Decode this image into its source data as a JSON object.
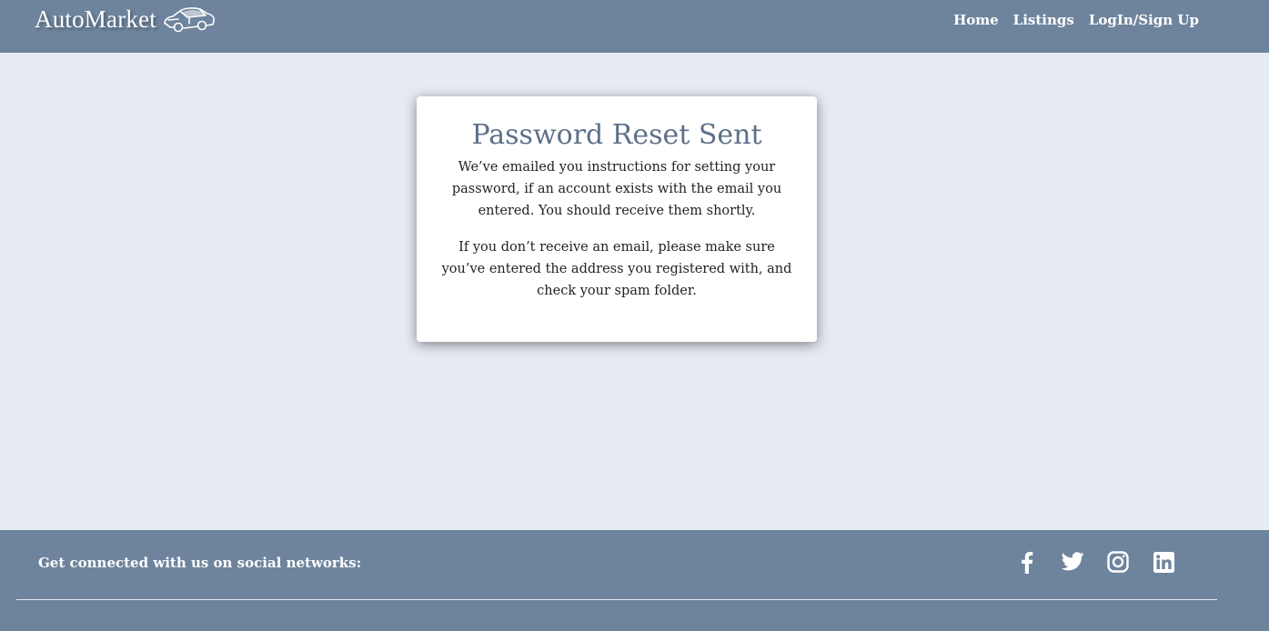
{
  "navbar": {
    "brand": "AutoMarket",
    "brand_icon": "car-icon",
    "links": [
      {
        "label": "Home"
      },
      {
        "label": "Listings"
      },
      {
        "label": "LogIn/Sign Up"
      }
    ]
  },
  "card": {
    "title": "Password Reset Sent",
    "paragraph_1": "We’ve emailed you instructions for setting your password, if an account exists with the email you entered. You should receive them shortly.",
    "paragraph_2": "If you don’t receive an email, please make sure you’ve entered the address you registered with, and check your spam folder."
  },
  "footer": {
    "text": "Get connected with us on social networks:",
    "social_icons": [
      "facebook-icon",
      "twitter-icon",
      "instagram-icon",
      "linkedin-icon"
    ]
  },
  "colors": {
    "header_footer_bg": "#6e849d",
    "page_bg": "#e6ebf3",
    "title": "#5d7088"
  }
}
